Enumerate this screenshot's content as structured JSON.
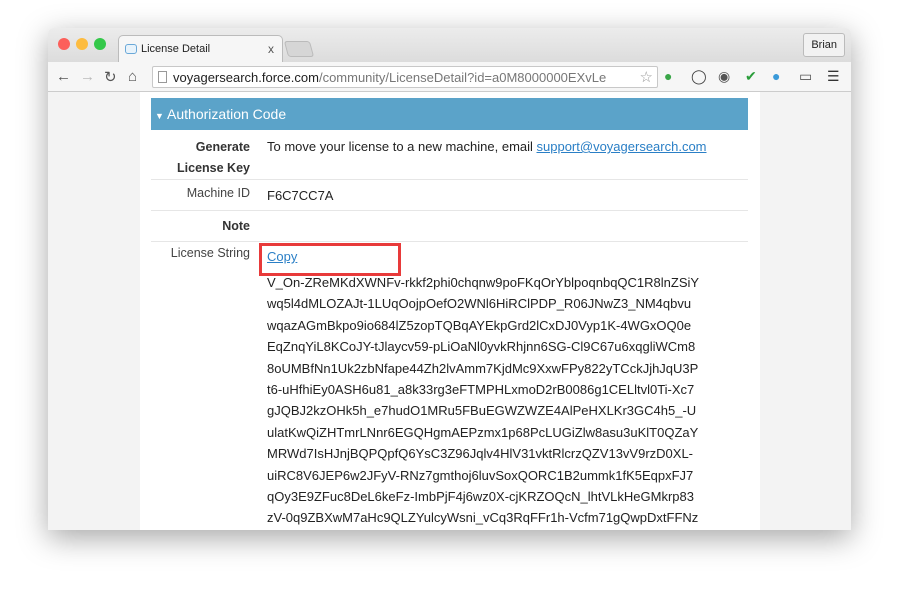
{
  "browser": {
    "tab_title": "License Detail",
    "tab_close": "x",
    "user": "Brian",
    "url_host": "voyagersearch.force.com",
    "url_path": "/community/LicenseDetail?id=a0M8000000EXvLe"
  },
  "section": {
    "title": "Authorization Code"
  },
  "rows": {
    "generate_label": "Generate License Key",
    "generate_text": "To move your license to a new machine, email ",
    "support_email": "support@voyagersearch.com",
    "machine_label": "Machine ID",
    "machine_id": "F6C7CC7A",
    "note_label": "Note",
    "license_label": "License String",
    "copy_label": "Copy"
  },
  "license_lines": [
    "V_On-ZReMKdXWNFv-rkkf2phi0chqnw9poFKqOrYblpoqnbqQC1R8lnZSiY",
    "wq5l4dMLOZAJt-1LUqOojpOefO2WNl6HiRClPDP_R06JNwZ3_NM4qbvu",
    "wqazAGmBkpo9io684lZ5zopTQBqAYEkpGrd2lCxDJ0Vyp1K-4WGxOQ0e",
    "EqZnqYiL8KCoJY-tJlaycv59-pLiOaNl0yvkRhjnn6SG-Cl9C67u6xqgliWCm8",
    "8oUMBfNn1Uk2zbNfape44Zh2lvAmm7KjdMc9XxwFPy822yTCckJjhJqU3P",
    "t6-uHfhiEy0ASH6u81_a8k33rg3eFTMPHLxmoD2rB0086g1CELltvl0Ti-Xc7",
    "gJQBJ2kzOHk5h_e7hudO1MRu5FBuEGWZWZE4AlPeHXLKr3GC4h5_-U",
    "ulatKwQiZHTmrLNnr6EGQHgmAEPzmx1p68PcLUGiZlw8asu3uKlT0QZaY",
    "MRWd7IsHJnjBQPQpfQ6YsC3Z96Jqlv4HlV31vktRlcrzQZV13vV9rzD0XL-",
    "uiRC8V6JEP6w2JFyV-RNz7gmthoj6luvSoxQORC1B2ummk1fK5EqpxFJ7",
    "qOy3E9ZFuc8DeL6keFz-ImbPjF4j6wz0X-cjKRZOQcN_lhtVLkHeGMkrp83",
    "zV-0q9ZBXwM7aHc9QLZYulcyWsni_vCq3RqFFr1h-Vcfm71gQwpDxtFFNz"
  ],
  "colors": {
    "header": "#5ba3c9",
    "link": "#2a7fc6",
    "highlight": "#e83a3a"
  }
}
